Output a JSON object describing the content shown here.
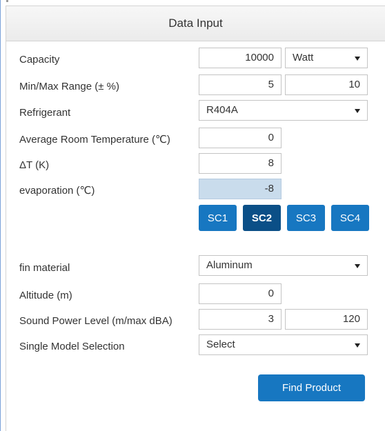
{
  "panel": {
    "title": "Data Input"
  },
  "fields": {
    "capacity": {
      "label": "Capacity",
      "value": "10000",
      "unit": "Watt"
    },
    "min_max_range": {
      "label": "Min/Max Range (± %)",
      "min": "5",
      "max": "10"
    },
    "refrigerant": {
      "label": "Refrigerant",
      "value": "R404A"
    },
    "avg_room_temp": {
      "label": "Average Room Temperature (℃)",
      "value": "0"
    },
    "delta_t": {
      "label": "ΔT (K)",
      "value": "8"
    },
    "evaporation": {
      "label": "evaporation (℃)",
      "value": "-8"
    },
    "fin_material": {
      "label": "fin material",
      "value": "Aluminum"
    },
    "altitude": {
      "label": "Altitude (m)",
      "value": "0"
    },
    "sound_power": {
      "label": "Sound Power Level (m/max dBA)",
      "min": "3",
      "max": "120"
    },
    "single_model": {
      "label": "Single Model Selection",
      "value": "Select"
    }
  },
  "sc_buttons": [
    {
      "label": "SC1",
      "active": false
    },
    {
      "label": "SC2",
      "active": true
    },
    {
      "label": "SC3",
      "active": false
    },
    {
      "label": "SC4",
      "active": false
    }
  ],
  "actions": {
    "find_product": "Find Product"
  },
  "colors": {
    "primary": "#1777c1",
    "primary_active": "#0b4f87",
    "readonly_fill": "#c9dcec",
    "border": "#c4c4c4"
  },
  "icons": {
    "dropdown": "caret-down-icon"
  }
}
